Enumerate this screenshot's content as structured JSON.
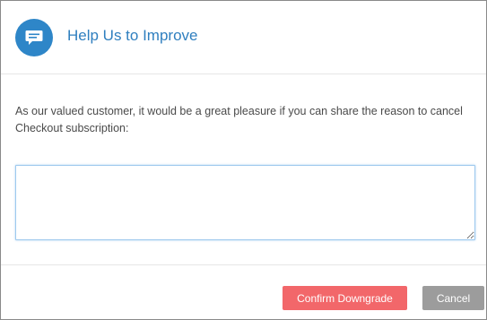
{
  "header": {
    "title": "Help Us to Improve",
    "icon": "chat-bubble-icon"
  },
  "body": {
    "prompt": "As our valued customer, it would be a great pleasure if you can share the reason to cancel Checkout subscription:",
    "reason_input": {
      "value": "",
      "placeholder": ""
    }
  },
  "footer": {
    "confirm_label": "Confirm Downgrade",
    "cancel_label": "Cancel"
  },
  "colors": {
    "accent": "#2e86c8",
    "title": "#2f7fbf",
    "confirm": "#f2676a",
    "cancel": "#9c9c9c"
  }
}
